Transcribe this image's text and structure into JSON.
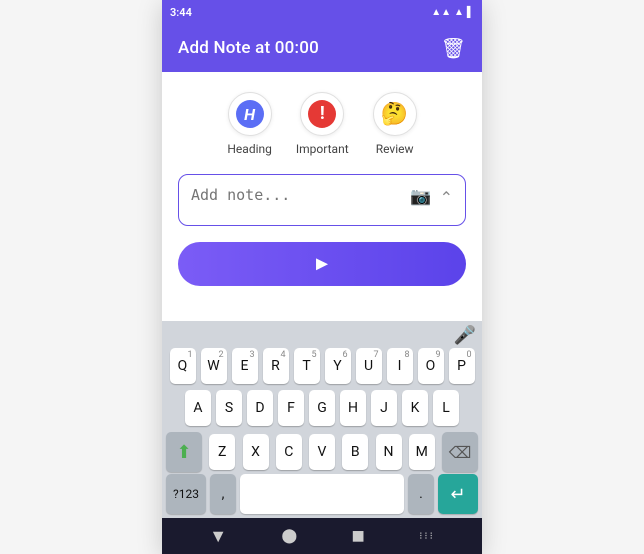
{
  "status_bar": {
    "time": "3:44",
    "icons_right": "▾▲ ▲▲ ▌"
  },
  "top_bar": {
    "title": "Add Note at 00:00",
    "delete_label": "🗑"
  },
  "tags": [
    {
      "id": "heading",
      "label": "Heading",
      "icon": "H",
      "icon_type": "heading"
    },
    {
      "id": "important",
      "label": "Important",
      "icon": "!",
      "icon_type": "important"
    },
    {
      "id": "review",
      "label": "Review",
      "icon": "🤔",
      "icon_type": "emoji"
    }
  ],
  "note_input": {
    "placeholder": "Add note...",
    "value": ""
  },
  "send_button_label": "➤",
  "keyboard": {
    "row1": [
      "Q",
      "W",
      "E",
      "R",
      "T",
      "Y",
      "U",
      "I",
      "O",
      "P"
    ],
    "row1_nums": [
      "1",
      "2",
      "3",
      "4",
      "5",
      "6",
      "7",
      "8",
      "9",
      "0"
    ],
    "row2": [
      "A",
      "S",
      "D",
      "F",
      "G",
      "H",
      "J",
      "K",
      "L"
    ],
    "row3": [
      "Z",
      "X",
      "C",
      "V",
      "B",
      "N",
      "M"
    ],
    "special_left": "⬆",
    "special_right": "⌫",
    "bottom": {
      "num_toggle": "?123",
      "comma": ",",
      "period": ".",
      "enter": "↵"
    }
  },
  "nav_bar": {
    "back": "▼",
    "home": "⬤",
    "recents": "▪"
  },
  "colors": {
    "accent": "#6650e8",
    "top_bar": "#6650e8",
    "keyboard_bg": "#d1d5db"
  }
}
